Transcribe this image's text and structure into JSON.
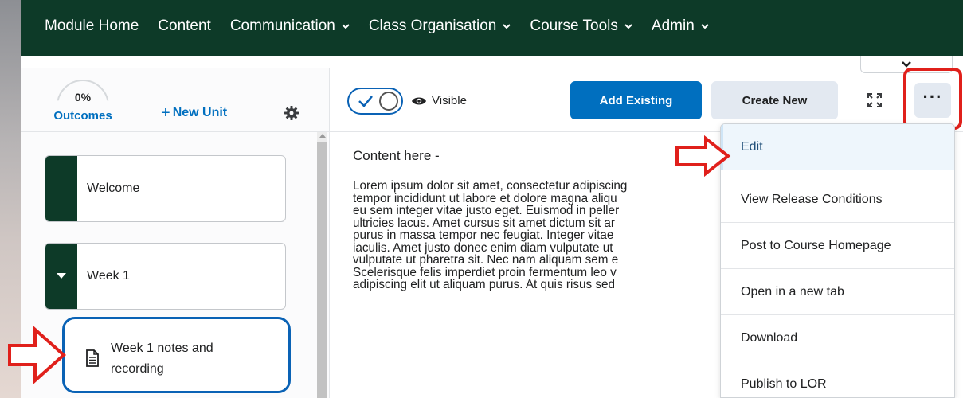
{
  "nav": {
    "items": [
      {
        "label": "Module Home",
        "has_dropdown": false
      },
      {
        "label": "Content",
        "has_dropdown": false
      },
      {
        "label": "Communication",
        "has_dropdown": true
      },
      {
        "label": "Class Organisation",
        "has_dropdown": true
      },
      {
        "label": "Course Tools",
        "has_dropdown": true
      },
      {
        "label": "Admin",
        "has_dropdown": true
      }
    ]
  },
  "sidebar": {
    "outcomes_percent": "0%",
    "outcomes_label": "Outcomes",
    "new_unit_label": "New Unit",
    "units": [
      {
        "label": "Welcome"
      },
      {
        "label": "Week 1"
      }
    ],
    "topic": {
      "label": "Week 1 notes and recording"
    }
  },
  "toolbar": {
    "visibility_label": "Visible",
    "add_existing_label": "Add Existing",
    "create_new_label": "Create New",
    "more_label": "···"
  },
  "content": {
    "heading": "Content here -",
    "lines": [
      "Lorem ipsum dolor sit amet, consectetur adipiscing",
      "tempor incididunt ut labore et dolore magna aliqu",
      "eu sem integer vitae justo eget. Euismod in peller",
      "ultricies lacus. Amet cursus sit amet dictum sit ar",
      "purus in massa tempor nec feugiat. Integer vitae",
      "iaculis. Amet justo donec enim diam vulputate ut",
      "vulputate ut pharetra sit. Nec nam aliquam sem e",
      "Scelerisque felis imperdiet proin fermentum leo v",
      "adipiscing elit ut aliquam purus. At quis risus sed"
    ]
  },
  "menu": {
    "items": [
      {
        "label": "Edit"
      },
      {
        "label": "View Release Conditions"
      },
      {
        "label": "Post to Course Homepage"
      },
      {
        "label": "Open in a new tab"
      },
      {
        "label": "Download"
      },
      {
        "label": "Publish to LOR"
      }
    ]
  },
  "colors": {
    "nav_bg": "#0d3a28",
    "primary": "#006fbf",
    "annotation_red": "#e0201b"
  }
}
